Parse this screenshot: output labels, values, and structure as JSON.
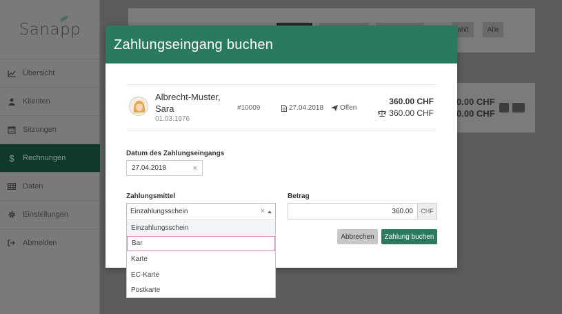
{
  "sidebar": {
    "logo": "Sanapp",
    "items": [
      {
        "label": "Übersicht",
        "icon": "line-chart-icon"
      },
      {
        "label": "Klienten",
        "icon": "user-icon"
      },
      {
        "label": "Sitzungen",
        "icon": "calendar-icon"
      },
      {
        "label": "Rechnungen",
        "icon": "dollar-icon",
        "active": true
      },
      {
        "label": "Daten",
        "icon": "table-icon"
      },
      {
        "label": "Einstellungen",
        "icon": "gear-icon"
      },
      {
        "label": "Abmelden",
        "icon": "sign-out-icon"
      }
    ]
  },
  "background": {
    "filter_partial": "ahlt",
    "filter_all": "Alle",
    "amount1": "0.00 CHF",
    "amount2": "0.00 CHF"
  },
  "modal": {
    "title": "Zahlungseingang buchen",
    "client": {
      "name": "Albrecht-Muster, Sara",
      "dob": "01.03.1976",
      "number": "#10009",
      "date": "27.04.2018",
      "status": "Offen",
      "amount_total": "360.00 CHF",
      "amount_open": "360.00 CHF"
    },
    "date_label": "Datum des Zahlungseingangs",
    "date_value": "27.04.2018",
    "method_label": "Zahlungsmittel",
    "method_value": "Einzahlungsschein",
    "amount_label": "Betrag",
    "amount_value": "360.00",
    "currency": "CHF",
    "cancel_label": "Abbrechen",
    "submit_label": "Zahlung buchen",
    "options": [
      "Einzahlungsschein",
      "Bar",
      "Karte",
      "EC-Karte",
      "Postkarte"
    ],
    "focused_option": "Bar"
  },
  "colors": {
    "accent": "#2b7a5f",
    "sidebar_active": "#0f3a2b",
    "focus_outline": "#d78bbd"
  }
}
